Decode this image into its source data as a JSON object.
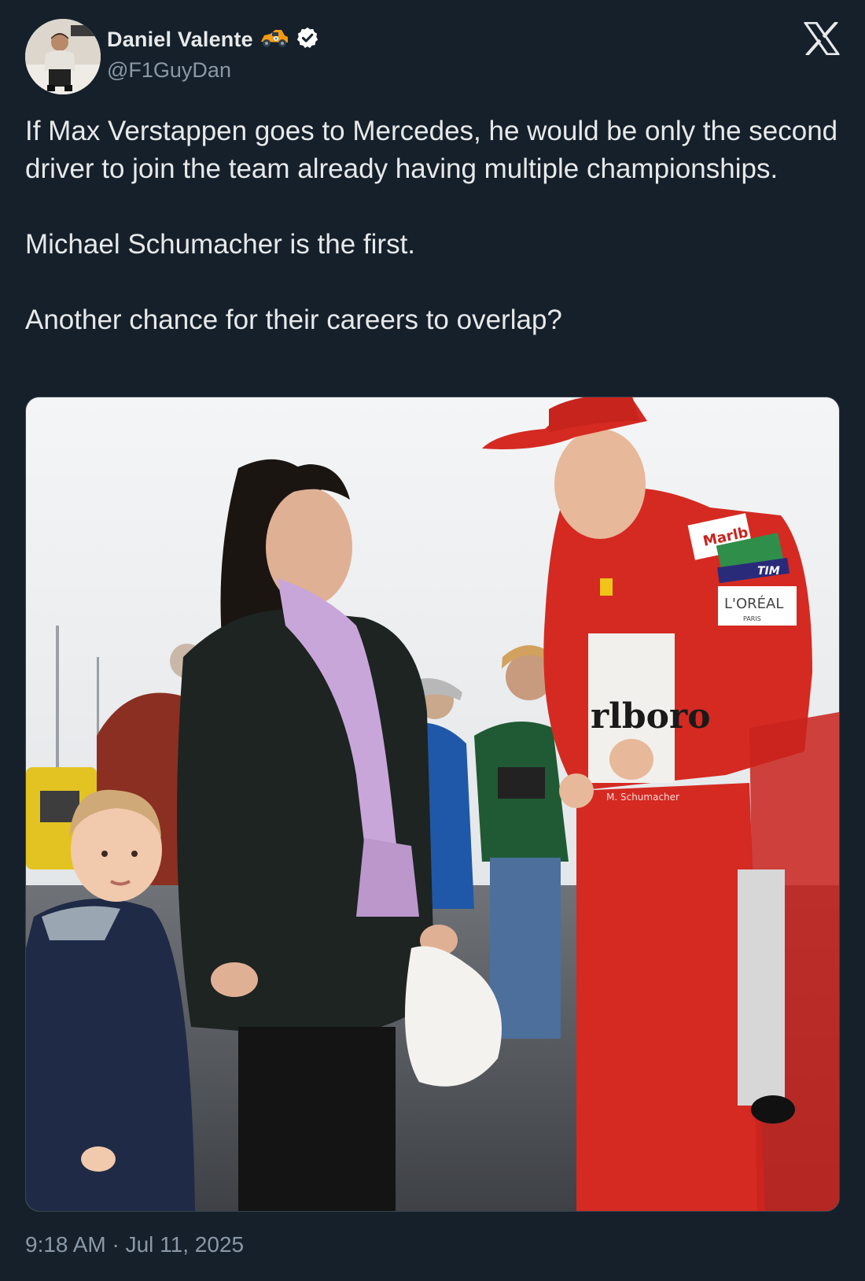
{
  "author": {
    "display_name": "Daniel Valente",
    "handle": "@F1GuyDan",
    "emoji_icon": "racing-car-emoji-icon",
    "verified": true
  },
  "tweet": {
    "paragraphs": [
      "If Max Verstappen goes to Mercedes, he would be only the second driver to join the team already having multiple championships.",
      "Michael Schumacher is the first.",
      "Another chance for their careers to overlap?"
    ],
    "timestamp": "9:18 AM · Jul 11, 2025"
  },
  "photo": {
    "suit_patches": [
      "Marlb",
      "TIM",
      "L'ORÉAL",
      "PARIS",
      "rlboro",
      "M. Schumacher"
    ]
  },
  "colors": {
    "background": "#15202b",
    "text_primary": "#e7e9ea",
    "text_secondary": "#8b98a5",
    "verified_badge": "#ffffff",
    "suit_red": "#d42a22"
  }
}
